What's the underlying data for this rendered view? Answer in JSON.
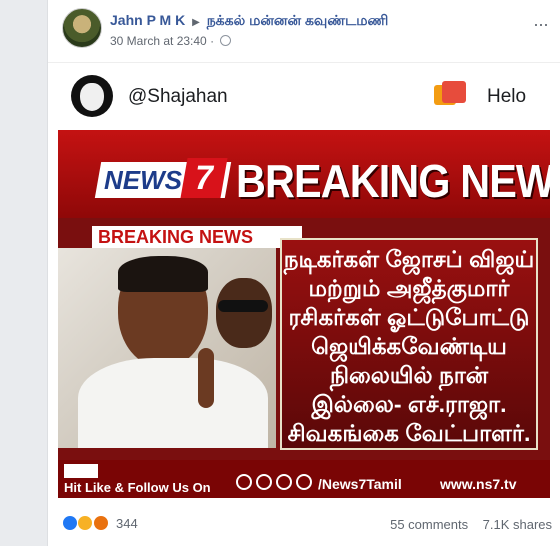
{
  "post": {
    "author": "Jahn P M K",
    "arrow": "▶",
    "group": "நக்கல் மன்னன் கவுண்டமணி",
    "timestamp": "30 March at 23:40",
    "more_label": "···"
  },
  "shared": {
    "handle": "@Shajahan",
    "right_label": "Helo"
  },
  "image": {
    "logo_news": "NEWS",
    "logo_seven": "7",
    "headline": "BREAKING NEWS",
    "sub_label": "BREAKING NEWS",
    "lines": [
      "நடிகர்கள் ஜோசப் விஜய்",
      "மற்றும் அஜீத்குமார்",
      "ரசிகர்கள் ஓட்டுபோட்டு",
      "ஜெயிக்கவேண்டிய",
      "நிலையில் நான்",
      "இல்லை- எச்.ராஜா.",
      "சிவகங்கை வேட்பாளர்."
    ],
    "follow_text": "Hit Like & Follow Us On",
    "social_handle": "/News7Tamil",
    "website": "www.ns7.tv"
  },
  "footer": {
    "reaction_count": "344",
    "comments": "55 comments",
    "shares": "7.1K shares"
  },
  "colors": {
    "link": "#385898",
    "news_red": "#c41212",
    "like_blue": "#2078f4"
  }
}
